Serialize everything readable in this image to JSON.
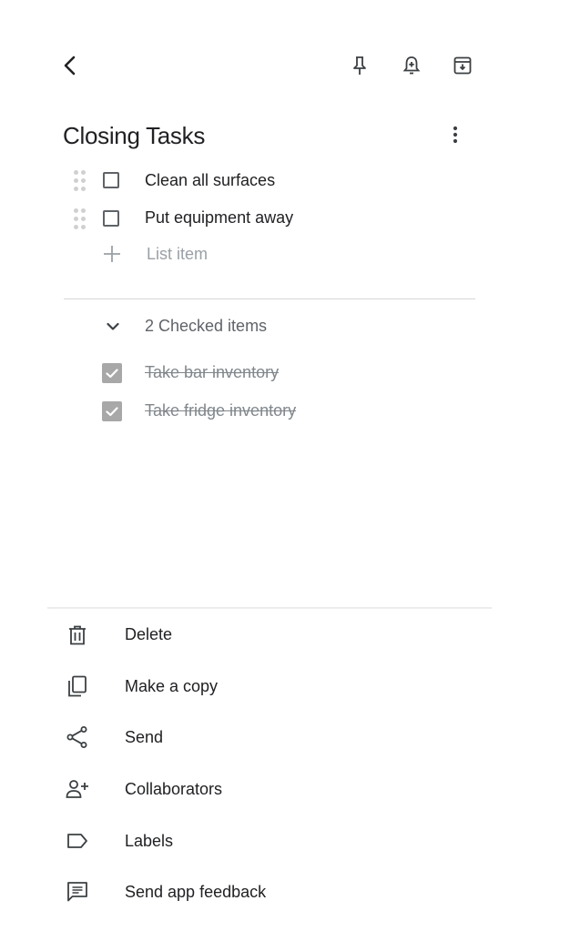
{
  "header": {
    "back_icon": "chevron-left-icon",
    "pin_icon": "pin-icon",
    "reminder_icon": "bell-plus-icon",
    "archive_icon": "archive-icon"
  },
  "note": {
    "title": "Closing Tasks",
    "more_icon": "more-vertical-icon",
    "items": [
      {
        "label": "Clean all surfaces",
        "checked": false
      },
      {
        "label": "Put equipment away",
        "checked": false
      }
    ],
    "add_item_placeholder": "List item",
    "checked_header": "2 Checked items",
    "checked_items": [
      {
        "label": "Take bar inventory",
        "checked": true
      },
      {
        "label": "Take fridge inventory",
        "checked": true
      }
    ]
  },
  "menu": {
    "items": [
      {
        "label": "Delete",
        "icon": "trash-icon"
      },
      {
        "label": "Make a copy",
        "icon": "copy-icon"
      },
      {
        "label": "Send",
        "icon": "share-icon"
      },
      {
        "label": "Collaborators",
        "icon": "person-add-icon"
      },
      {
        "label": "Labels",
        "icon": "label-icon"
      },
      {
        "label": "Send app feedback",
        "icon": "feedback-icon"
      }
    ]
  },
  "colors": {
    "text": "#202124",
    "muted": "#5f6368",
    "checked_box": "#a8a8a8",
    "divider": "#d7d7d7"
  }
}
